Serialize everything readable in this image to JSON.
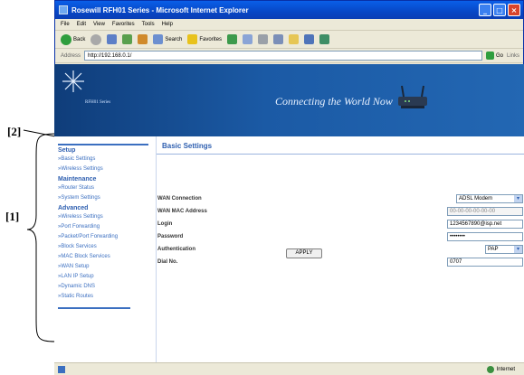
{
  "window": {
    "title": "Rosewill RFH01 Series - Microsoft Internet Explorer"
  },
  "menu": [
    "File",
    "Edit",
    "View",
    "Favorites",
    "Tools",
    "Help"
  ],
  "toolbar": {
    "back": "Back",
    "search": "Search",
    "favorites": "Favorites"
  },
  "address": {
    "label": "Address",
    "url": "http://192.168.0.1/",
    "go": "Go",
    "links": "Links"
  },
  "banner": {
    "series": "RFH01 Series",
    "tagline": "Connecting the World Now"
  },
  "callouts": {
    "label_1": "[1]",
    "label_2": "[2]"
  },
  "nav": {
    "groups": [
      {
        "title": "Setup",
        "items": [
          "Basic Settings",
          "Wireless Settings"
        ]
      },
      {
        "title": "Maintenance",
        "items": [
          "Router Status",
          "System Settings"
        ]
      },
      {
        "title": "Advanced",
        "items": [
          "Wireless Settings",
          "Port Forwarding",
          "Packet/Port Forwarding",
          "Block Services",
          "MAC Block Services",
          "WAN Setup",
          "LAN IP Setup",
          "Dynamic DNS",
          "Static Routes"
        ]
      }
    ]
  },
  "content": {
    "title": "Basic Settings",
    "fields": [
      {
        "label": "WAN Connection",
        "value": "ADSL Modem"
      },
      {
        "label": "WAN MAC Address",
        "value": "00-00-00-00-00-00"
      },
      {
        "label": "Login",
        "value": "1234567890@isp.net"
      },
      {
        "label": "Password",
        "value": "••••••••"
      },
      {
        "label": "Authentication",
        "value": "PAP"
      },
      {
        "label": "Dial No.",
        "value": "0707"
      }
    ],
    "apply": "APPLY"
  },
  "status": {
    "zone": "Internet"
  }
}
